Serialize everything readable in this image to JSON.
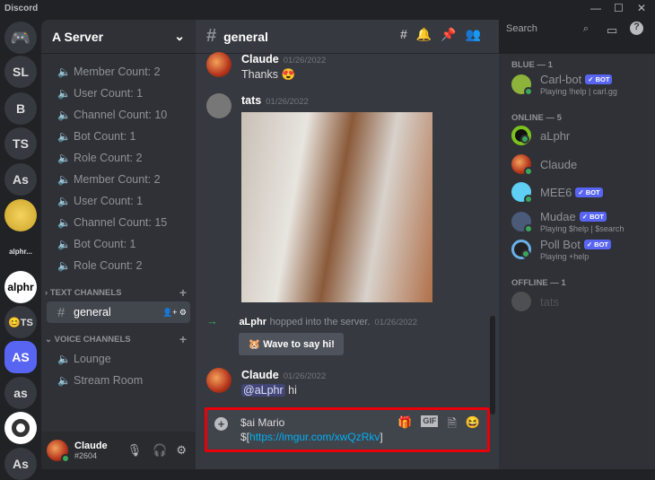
{
  "app": {
    "title": "Discord",
    "min": "—",
    "max": "☐",
    "close": "✕"
  },
  "servers": [
    "SL",
    "B",
    "TS",
    "As",
    "alphr...",
    "alphr",
    "😊TS",
    "AS",
    "as",
    "As"
  ],
  "sidebar": {
    "server_name": "A Server",
    "voice_stats": [
      "Member Count: 2",
      "User Count: 1",
      "Channel Count: 10",
      "Bot Count: 1",
      "Role Count: 2",
      "Member Count: 2",
      "User Count: 1",
      "Channel Count: 15",
      "Bot Count: 1",
      "Role Count: 2"
    ],
    "text_category": "TEXT CHANNELS",
    "text_channels": [
      "general"
    ],
    "voice_category": "VOICE CHANNELS",
    "voice_channels": [
      "Lounge",
      "Stream Room"
    ]
  },
  "user_panel": {
    "name": "Claude",
    "tag": "#2604"
  },
  "header": {
    "channel": "general",
    "search_placeholder": "Search"
  },
  "messages": [
    {
      "author": "Claude",
      "time": "01/26/2022",
      "text": "Thanks 😍"
    },
    {
      "author": "tats",
      "time": "01/26/2022",
      "text": ""
    },
    {
      "author": "aLphr",
      "action": "hopped into the server.",
      "time": "01/26/2022",
      "button": "Wave to say hi!"
    },
    {
      "author": "Claude",
      "time": "01/26/2022",
      "mention": "@aLphr",
      "text": "hi"
    }
  ],
  "input": {
    "line1": "$ai Mario",
    "prefix": "$[",
    "link": "https://imgur.com/xwQzRkv",
    "suffix": "]",
    "gif": "GIF"
  },
  "members": {
    "groups": [
      {
        "label": "BLUE — 1",
        "items": [
          {
            "name": "Carl-bot",
            "bot": "✓ BOT",
            "status": "Playing !help | carl.gg"
          }
        ]
      },
      {
        "label": "ONLINE — 5",
        "items": [
          {
            "name": "aLphr"
          },
          {
            "name": "Claude"
          },
          {
            "name": "MEE6",
            "bot": "✓ BOT"
          },
          {
            "name": "Mudae",
            "bot": "✓ BOT",
            "status": "Playing $help | $search"
          },
          {
            "name": "Poll Bot",
            "bot": "✓ BOT",
            "status": "Playing +help"
          }
        ]
      },
      {
        "label": "OFFLINE — 1",
        "items": [
          {
            "name": "tats"
          }
        ]
      }
    ]
  },
  "colors": {
    "accent": "#5865f2",
    "online": "#3ba55d",
    "link": "#00aff4",
    "highlight": "#e8000b"
  }
}
